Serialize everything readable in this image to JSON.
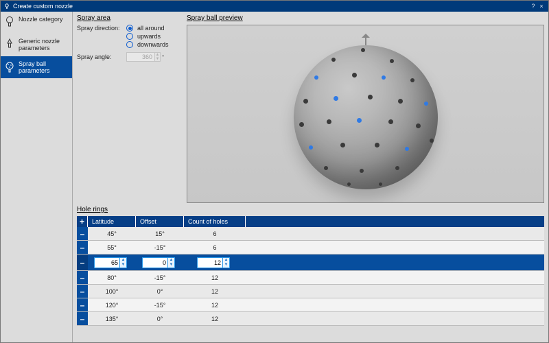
{
  "window": {
    "title": "Create custom nozzle"
  },
  "sidebar": {
    "items": [
      {
        "label": "Nozzle category"
      },
      {
        "label": "Generic nozzle parameters"
      },
      {
        "label": "Spray ball parameters"
      }
    ],
    "active_index": 2
  },
  "spray_area": {
    "title": "Spray area",
    "direction_label": "Spray direction:",
    "options": [
      {
        "label": "all around",
        "checked": true
      },
      {
        "label": "upwards",
        "checked": false
      },
      {
        "label": "downwards",
        "checked": false
      }
    ],
    "angle_label": "Spray angle:",
    "angle_value": "360"
  },
  "preview": {
    "title": "Spray ball preview"
  },
  "hole_rings": {
    "title": "Hole rings",
    "headers": {
      "latitude": "Latitude",
      "offset": "Offset",
      "count": "Count of holes"
    },
    "rows": [
      {
        "latitude": "45°",
        "offset": "15°",
        "count": "6"
      },
      {
        "latitude": "55°",
        "offset": "-15°",
        "count": "6"
      },
      {
        "latitude": "65",
        "offset": "0",
        "count": "12",
        "editing": true
      },
      {
        "latitude": "80°",
        "offset": "-15°",
        "count": "12"
      },
      {
        "latitude": "100°",
        "offset": "0°",
        "count": "12"
      },
      {
        "latitude": "120°",
        "offset": "-15°",
        "count": "12"
      },
      {
        "latitude": "135°",
        "offset": "0°",
        "count": "12"
      }
    ]
  }
}
